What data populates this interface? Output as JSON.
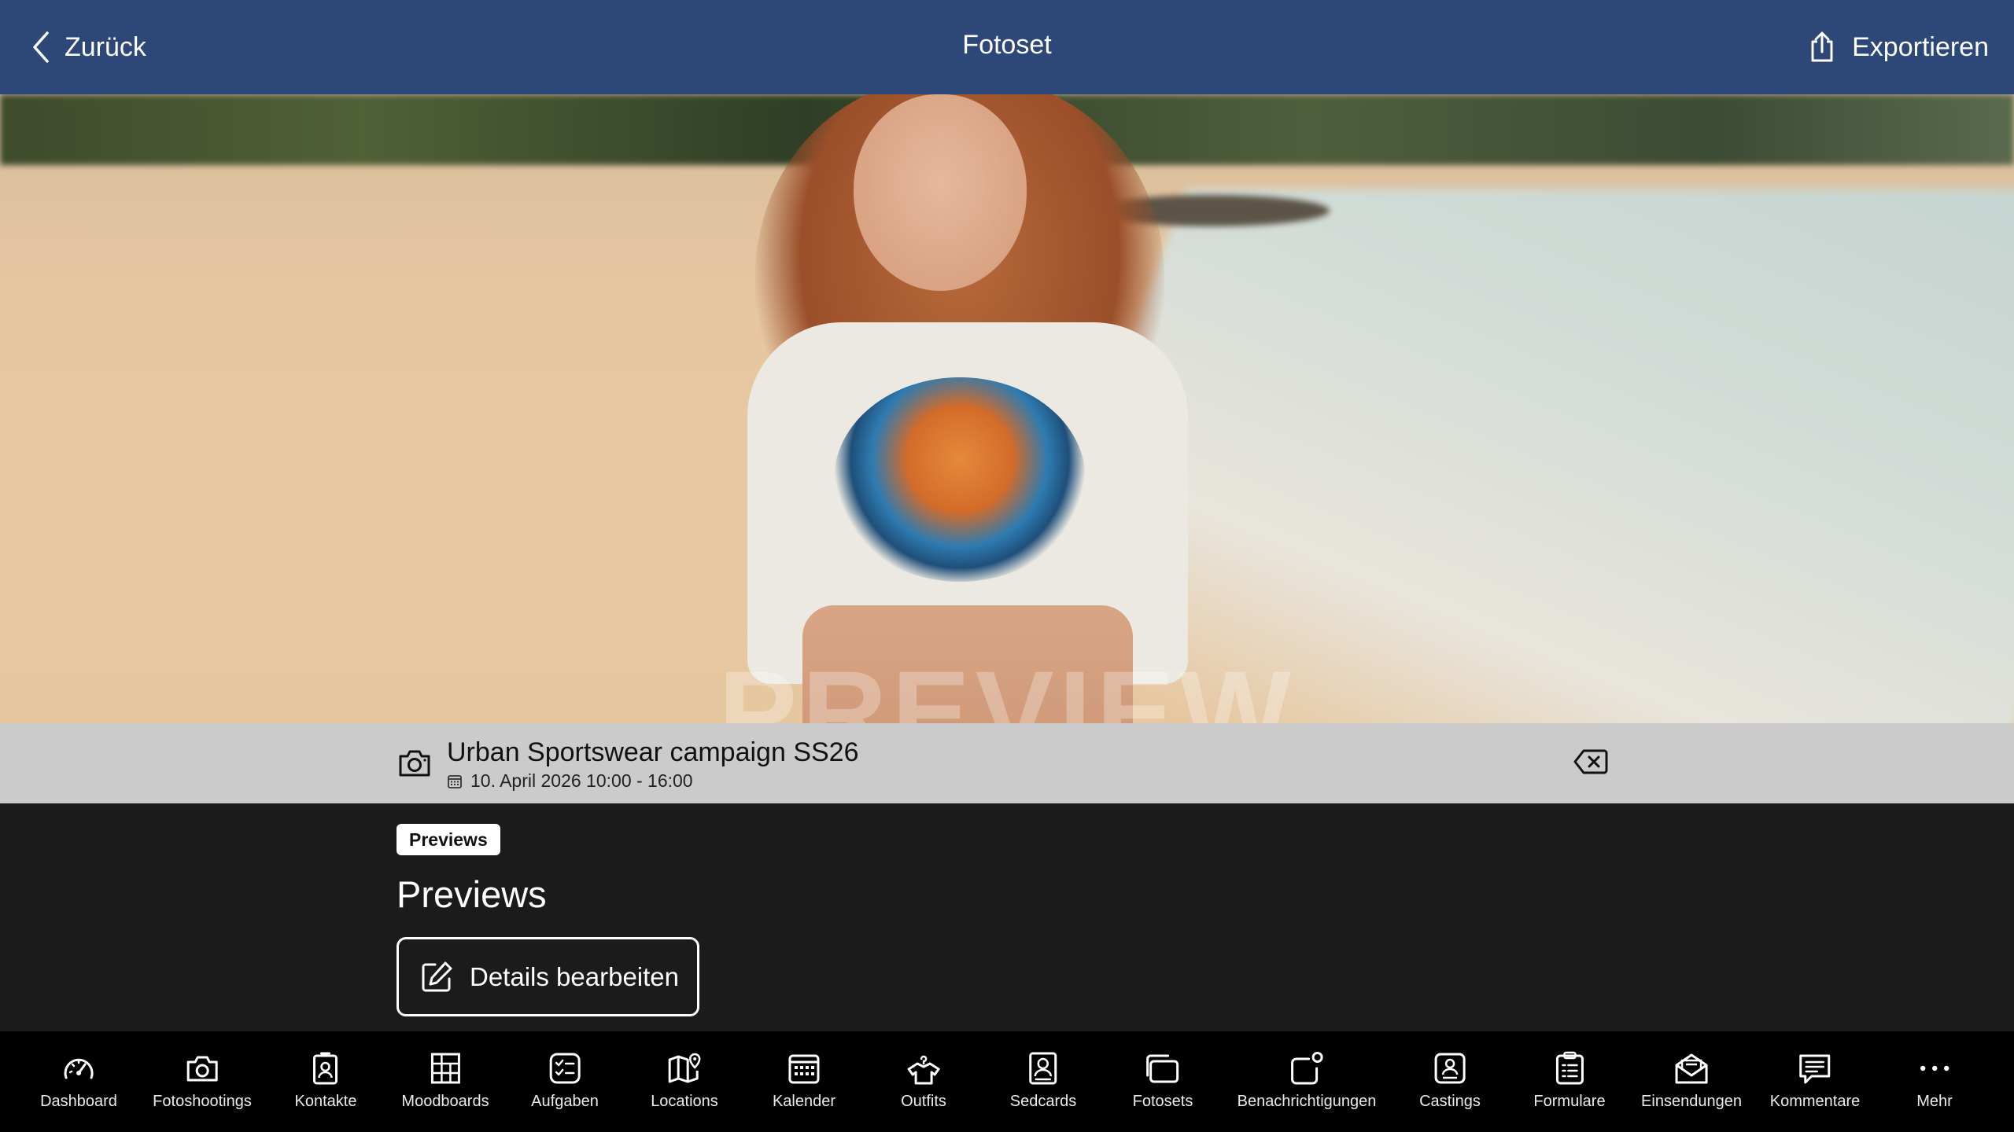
{
  "header": {
    "back_label": "Zurück",
    "title": "Fotoset",
    "export_label": "Exportieren"
  },
  "hero": {
    "watermark": "PREVIEW"
  },
  "shooting": {
    "name": "Urban Sportswear campaign SS26",
    "date": "10. April 2026 10:00 - 16:00"
  },
  "content": {
    "badge": "Previews",
    "heading": "Previews",
    "edit_label": "Details bearbeiten"
  },
  "tabbar": {
    "items": [
      {
        "label": "Dashboard",
        "icon": "gauge-icon"
      },
      {
        "label": "Fotoshootings",
        "icon": "camera-icon"
      },
      {
        "label": "Kontakte",
        "icon": "contact-card-icon"
      },
      {
        "label": "Moodboards",
        "icon": "moodboard-grid-icon"
      },
      {
        "label": "Aufgaben",
        "icon": "checklist-icon"
      },
      {
        "label": "Locations",
        "icon": "map-pin-icon"
      },
      {
        "label": "Kalender",
        "icon": "calendar-icon"
      },
      {
        "label": "Outfits",
        "icon": "shirt-hanger-icon"
      },
      {
        "label": "Sedcards",
        "icon": "portrait-card-icon"
      },
      {
        "label": "Fotosets",
        "icon": "photo-stack-icon"
      },
      {
        "label": "Benachrichtigungen",
        "icon": "notification-icon"
      },
      {
        "label": "Castings",
        "icon": "casting-badge-icon"
      },
      {
        "label": "Formulare",
        "icon": "clipboard-form-icon"
      },
      {
        "label": "Einsendungen",
        "icon": "envelope-open-icon"
      },
      {
        "label": "Kommentare",
        "icon": "comment-icon"
      },
      {
        "label": "Mehr",
        "icon": "more-dots-icon"
      }
    ]
  }
}
